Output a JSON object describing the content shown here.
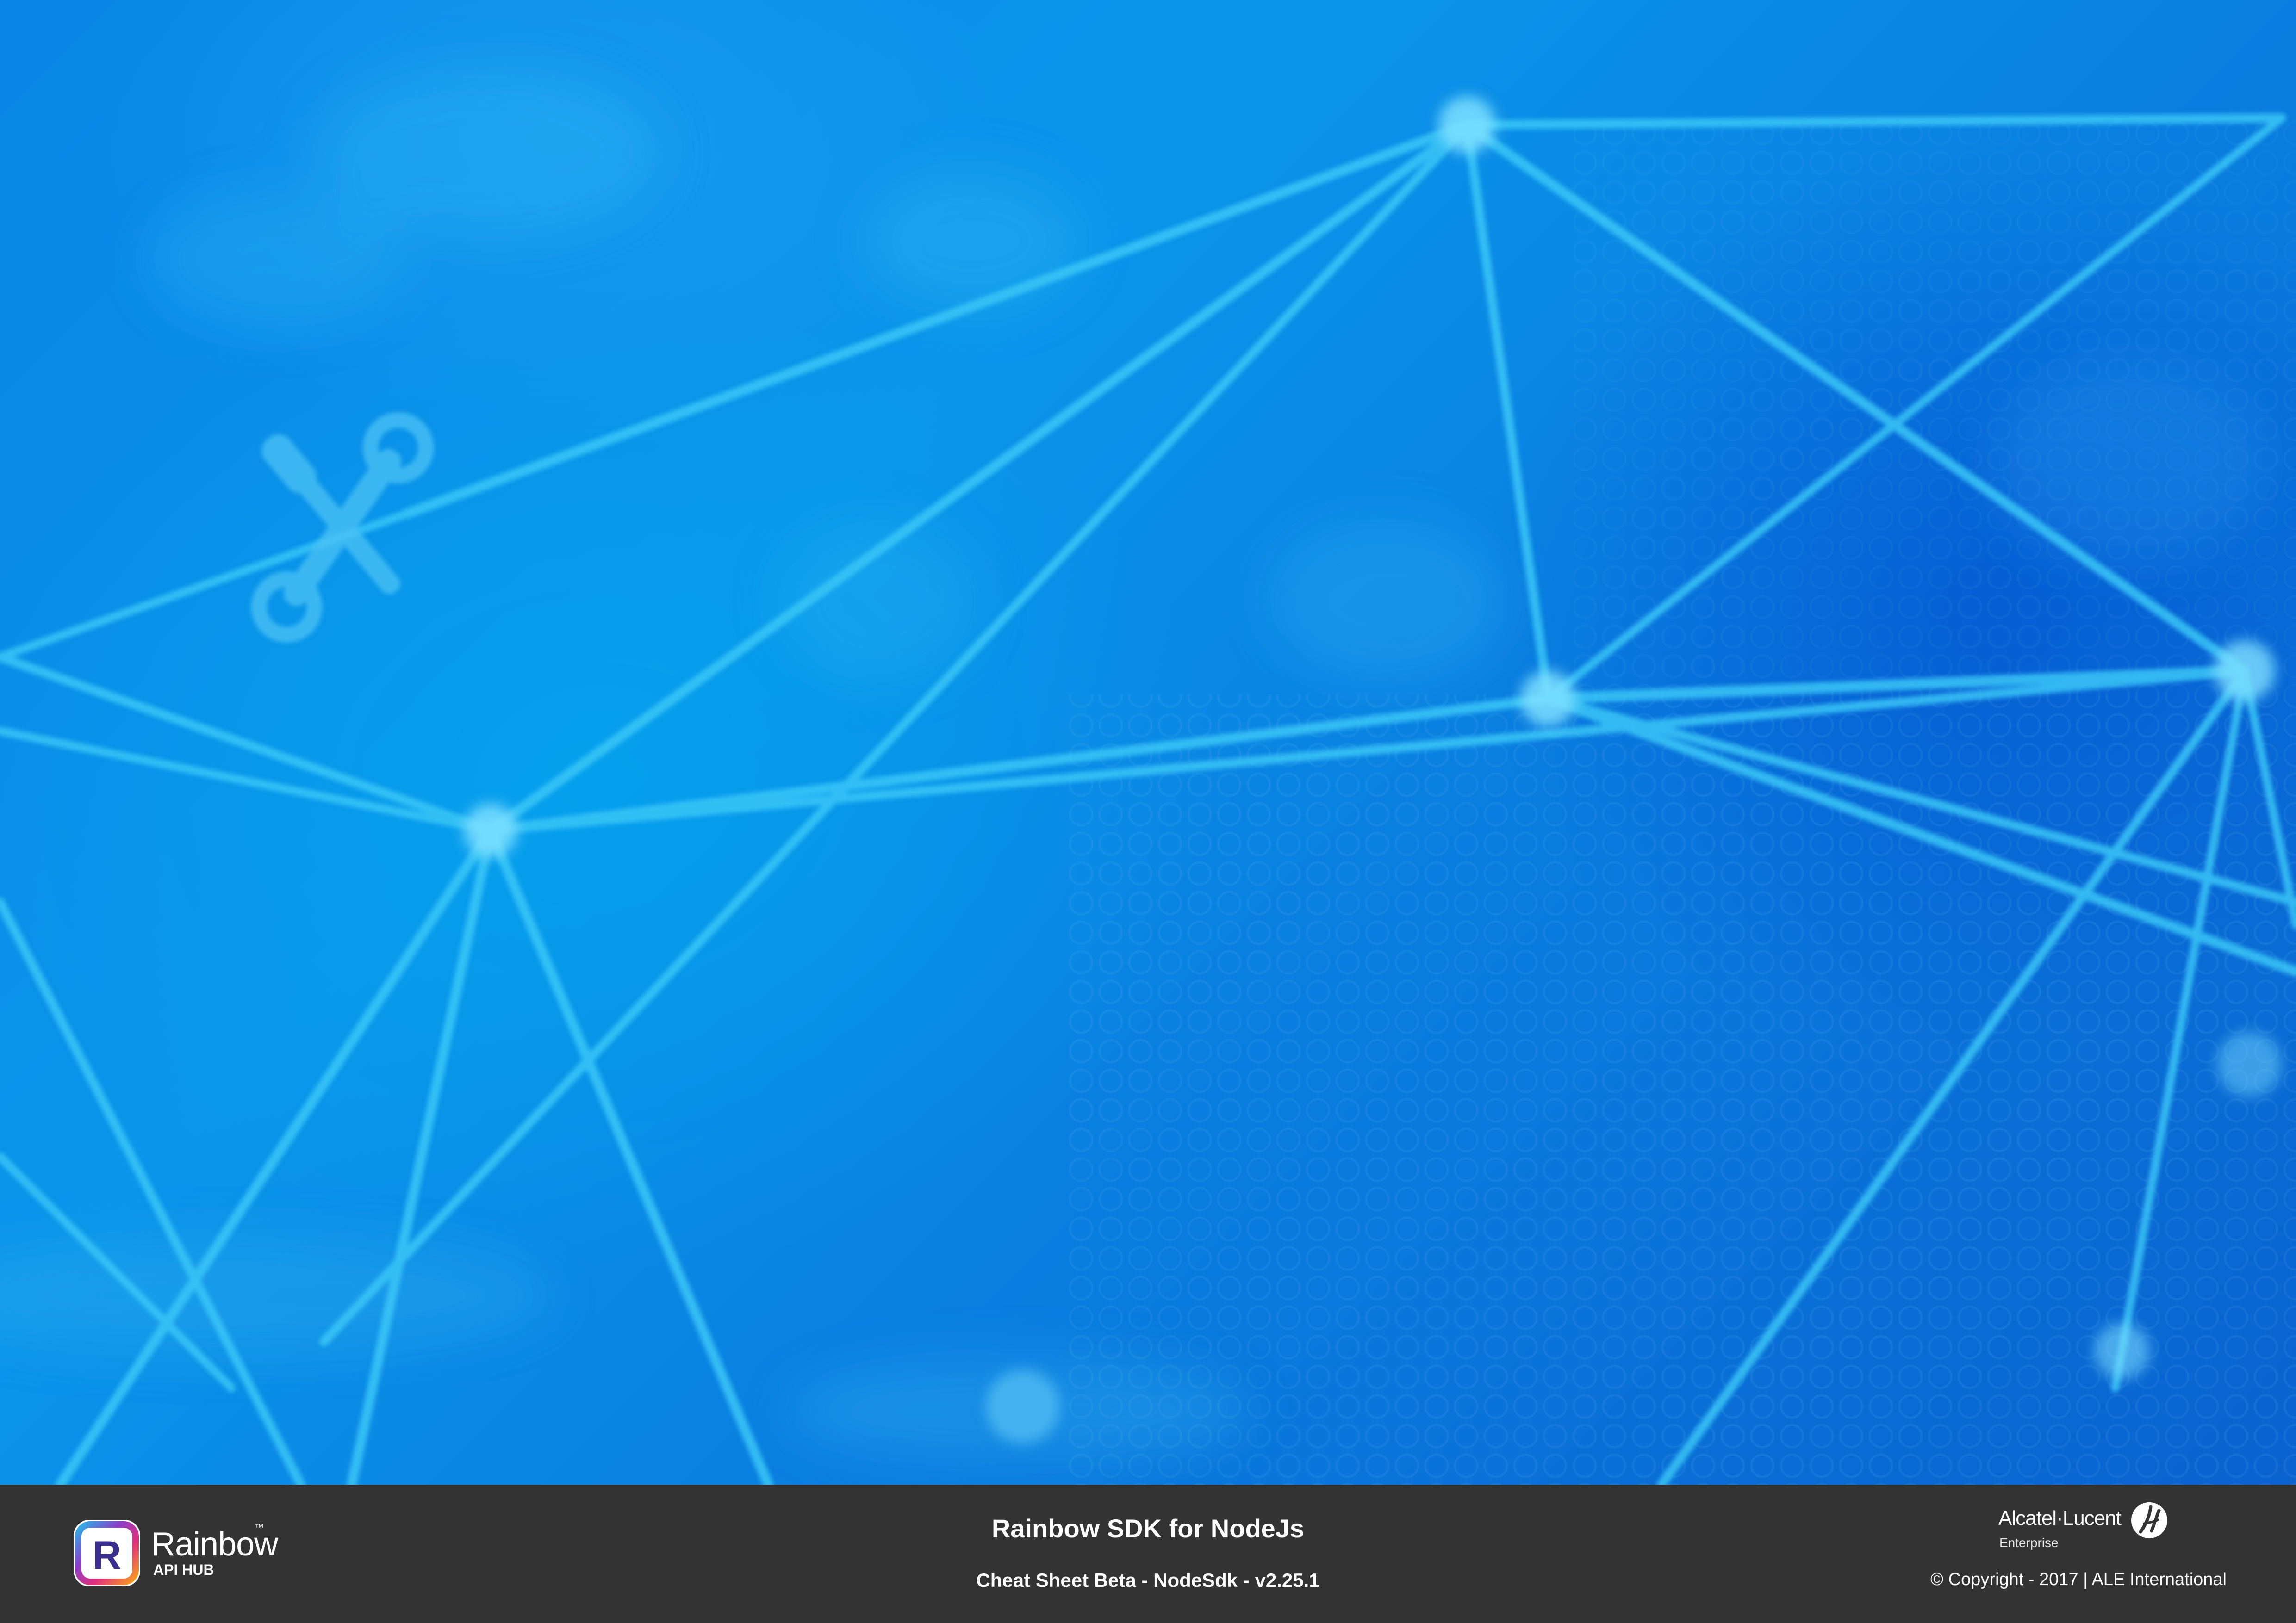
{
  "colors": {
    "footer_bg": "#333333",
    "hero_blue": "#0a86e6",
    "network_line": "#35c4f5",
    "text": "#ffffff"
  },
  "hero": {
    "decorative_icon": "wrench-screwdriver-icon"
  },
  "footer": {
    "brand": {
      "name": "Rainbow",
      "trademark": "™",
      "subtitle": "API HUB",
      "icon": "rainbow-logo-icon"
    },
    "title": "Rainbow SDK for NodeJs",
    "subtitle": "Cheat Sheet Beta - NodeSdk - v2.25.1",
    "vendor": {
      "name": "Alcatel·Lucent",
      "division": "Enterprise",
      "icon": "alcatel-lucent-logo-icon"
    },
    "copyright": "© Copyright - 2017 | ALE International"
  }
}
